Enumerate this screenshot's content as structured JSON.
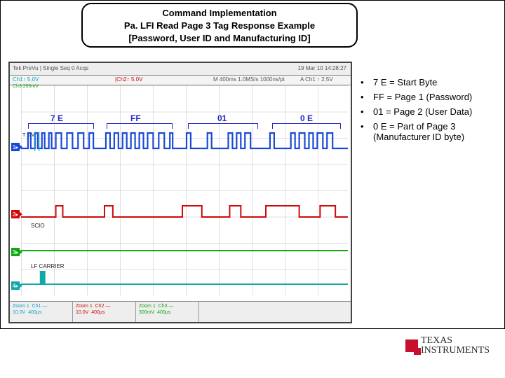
{
  "title": {
    "line1": "Command Implementation",
    "line2": "Pa. LFI Read Page 3 Tag Response Example",
    "line3": "[Password, User ID and Manufacturing ID]"
  },
  "scope": {
    "topbar": {
      "left": "Tek   PreVu | Single Seq        0 Acqs",
      "right": "19 Mar 10 14:28:27"
    },
    "subbar": {
      "ch1": "Ch1↑  5.0V",
      "ch2": "|Ch2↑  5.0V",
      "m": "M 400ms  1.0MS/s  1000ns/pt",
      "ach": "A Ch1 ↑ 2.5V",
      "ch3": "Ch3  200mV"
    },
    "bytes": {
      "b1": "7 E",
      "b2": "FF",
      "b3": "01",
      "b4": "0 E"
    },
    "labels": {
      "scio": "SCIO",
      "lf": "LF CARRIER",
      "txv": "T XIV"
    },
    "footer": {
      "c1a": "Zoom 1",
      "c1b": "10.0V",
      "c1c": "Ch1 —",
      "c1d": "400µs",
      "c2a": "Zoom 1",
      "c2b": "10.0V",
      "c2c": "Ch2 —",
      "c2d": "400µs",
      "c3a": "Zoom 1",
      "c3b": "300mV",
      "c3c": "Ch3 —",
      "c3d": "400µs"
    }
  },
  "bullets": {
    "b1": "7 E = Start Byte",
    "b2": "FF = Page 1 (Password)",
    "b3": "01 = Page 2 (User Data)",
    "b4a": "0 E = Part of Page 3",
    "b4b": "(Manufacturer ID byte)"
  },
  "logo": {
    "line1": "TEXAS",
    "line2": "INSTRUMENTS"
  },
  "chart_data": {
    "type": "oscilloscope-digital",
    "horizontal_division": "400µs",
    "channels": [
      {
        "name": "Ch1",
        "label": "T XIV",
        "color": "#1a48d8",
        "scale": "5.0V / 10.0V zoom",
        "decoded_bytes": [
          "7E",
          "FF",
          "01",
          "0E"
        ],
        "description": "Digital serial stream, active-low pulses grouped into four bytes across the window"
      },
      {
        "name": "Ch2",
        "label": "SCIO",
        "color": "#cc0a0a",
        "scale": "5.0V / 10.0V zoom",
        "description": "Mostly low with periodic short high pulses, one per bit group approx"
      },
      {
        "name": "Ch3",
        "label": "",
        "color": "#13a813",
        "scale": "200mV / 300mV zoom",
        "description": "Flat near baseline, continuous"
      },
      {
        "name": "Ch4",
        "label": "LF CARRIER",
        "color": "#12a8a8",
        "scale": "",
        "description": "Flat low with a single narrow burst near start of window"
      }
    ],
    "title": "Pa.LFI Read Page 3 Tag Response",
    "trigger": "A Ch1 ↑ 2.5V",
    "timebase": "M 400ms 1.0MS/s 1000ns/pt"
  }
}
